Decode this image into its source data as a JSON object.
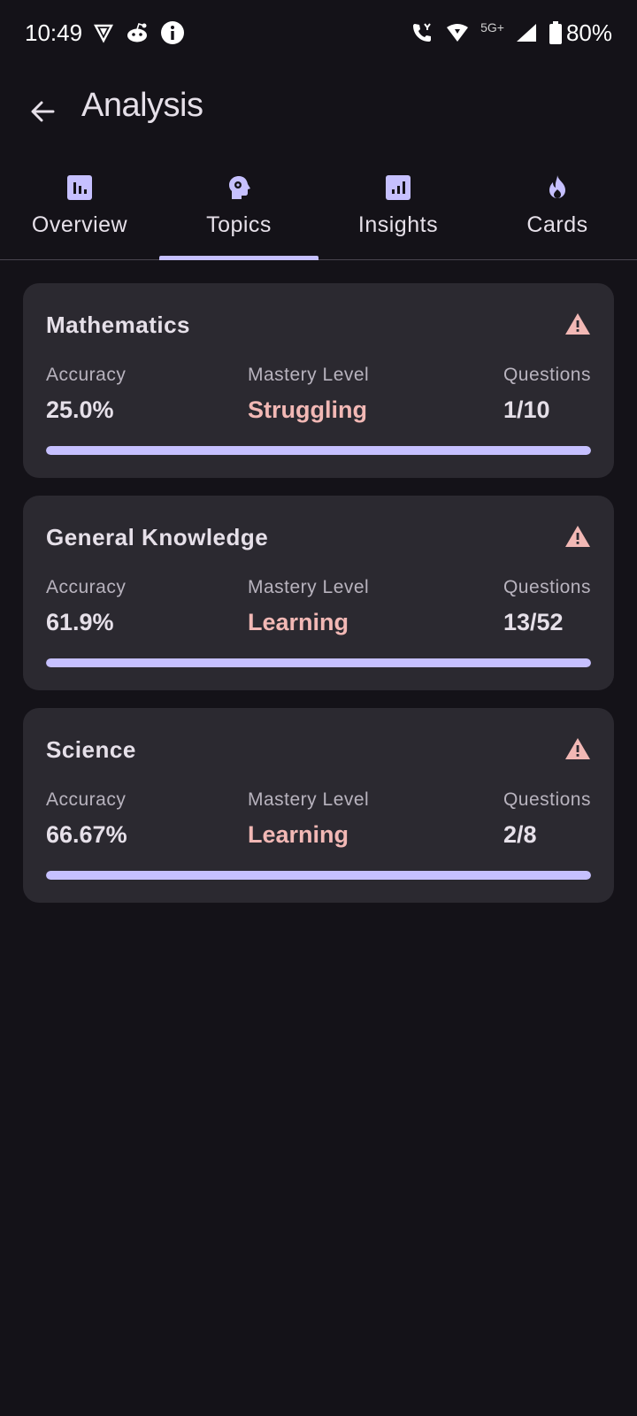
{
  "status_bar": {
    "time": "10:49",
    "network": "5G+",
    "battery": "80%",
    "icons_left": [
      "vpn-shield-icon",
      "reddit-icon",
      "info-icon"
    ],
    "icons_right": [
      "wifi-calling-icon",
      "wifi-icon",
      "signal-icon",
      "battery-icon"
    ]
  },
  "header": {
    "title": "Analysis",
    "back_icon": "arrow-back-icon"
  },
  "tabs": [
    {
      "label": "Overview",
      "icon": "bar-chart-icon",
      "selected": false
    },
    {
      "label": "Topics",
      "icon": "head-brain-icon",
      "selected": true
    },
    {
      "label": "Insights",
      "icon": "analytics-icon",
      "selected": false
    },
    {
      "label": "Cards",
      "icon": "flame-icon",
      "selected": false
    }
  ],
  "labels": {
    "accuracy": "Accuracy",
    "mastery": "Mastery Level",
    "questions": "Questions"
  },
  "topics": [
    {
      "name": "Mathematics",
      "accuracy": "25.0%",
      "mastery": "Struggling",
      "questions": "1/10",
      "progress": 1.0
    },
    {
      "name": "General Knowledge",
      "accuracy": "61.9%",
      "mastery": "Learning",
      "questions": "13/52",
      "progress": 1.0
    },
    {
      "name": "Science",
      "accuracy": "66.67%",
      "mastery": "Learning",
      "questions": "2/8",
      "progress": 1.0
    }
  ],
  "colors": {
    "background": "#141218",
    "card": "#2B2930",
    "accent": "#C6C0FF",
    "warning": "#F2B8B5"
  }
}
